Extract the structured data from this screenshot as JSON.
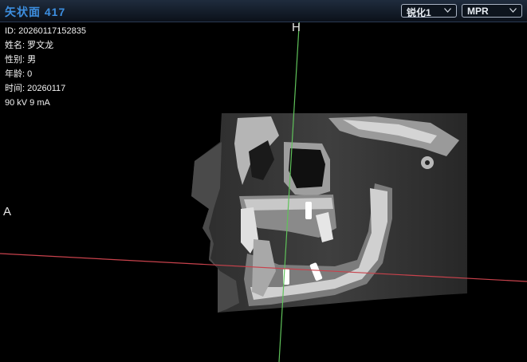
{
  "title": "矢状面 417",
  "sharpen_select": {
    "value": "锐化1"
  },
  "mode_select": {
    "value": "MPR"
  },
  "patient": {
    "id_line": "ID: 20260117152835",
    "name_line": "姓名: 罗文龙",
    "sex_line": "性别: 男",
    "age_line": "年龄: 0",
    "time_line": "时间: 20260117",
    "exposure_line": "90 kV  9 mA"
  },
  "orientation": {
    "top": "H",
    "left": "A"
  },
  "colors": {
    "title_blue": "#3d8fe0",
    "crosshair_vertical": "#5fc25a",
    "crosshair_horizontal": "#c8424c",
    "background": "#000000"
  },
  "icons": {
    "dropdown_arrow": "chevron-down-icon"
  }
}
